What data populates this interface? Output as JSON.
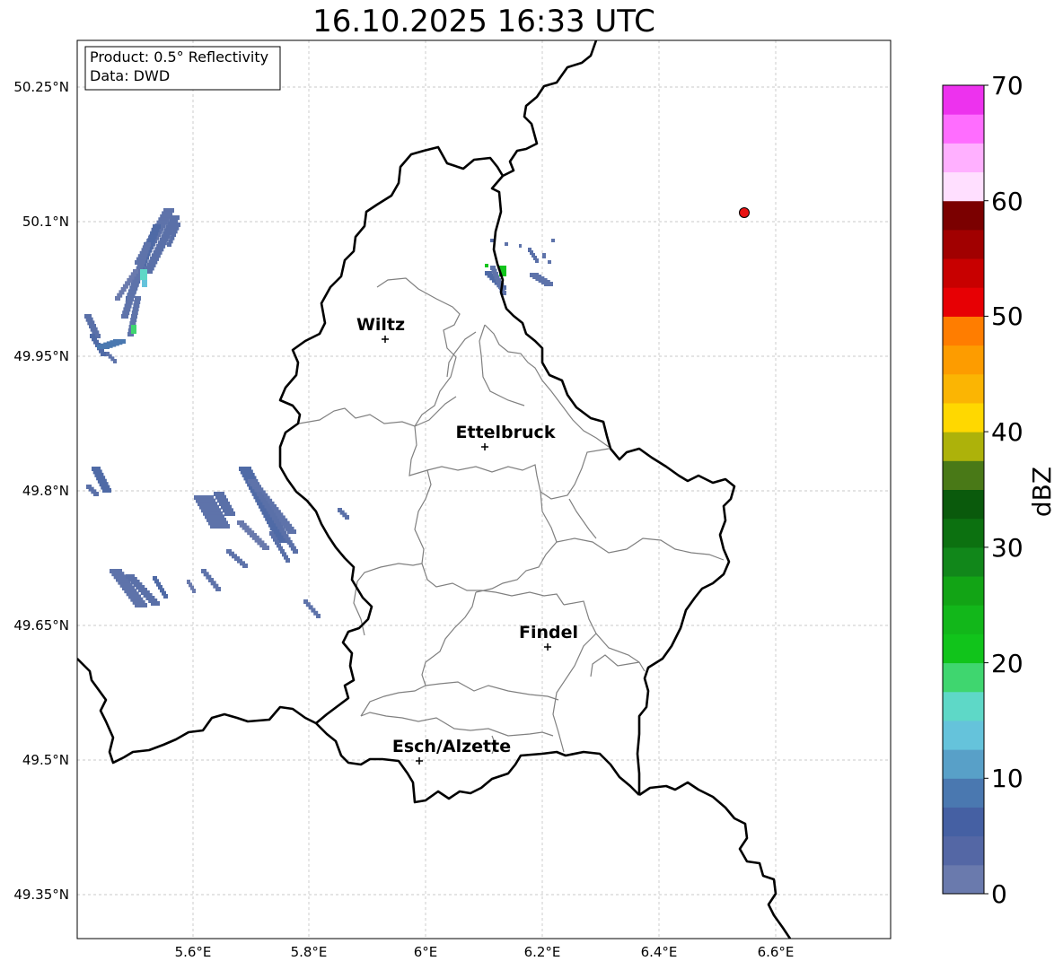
{
  "title": "16.10.2025 16:33 UTC",
  "info_box": {
    "line1": "Product: 0.5° Reflectivity",
    "line2": "Data: DWD"
  },
  "map": {
    "lon_ticks": [
      "5.6°E",
      "5.8°E",
      "6°E",
      "6.2°E",
      "6.4°E",
      "6.6°E"
    ],
    "lat_ticks": [
      "50.25°N",
      "50.1°N",
      "49.95°N",
      "49.8°N",
      "49.65°N",
      "49.5°N",
      "49.35°N"
    ],
    "cities": [
      {
        "name": "Wiltz",
        "marker": "cross"
      },
      {
        "name": "Ettelbruck",
        "marker": "cross"
      },
      {
        "name": "Findel",
        "marker": "cross"
      },
      {
        "name": "Esch/Alzette",
        "marker": "cross"
      }
    ],
    "radar_site": {
      "color": "#e81212"
    },
    "border_color": "#000000",
    "admin_border_color": "#808080",
    "grid": true
  },
  "colorbar": {
    "label": "dBZ",
    "min": 0,
    "max": 70,
    "step": 2.5,
    "tick_labels": [
      "0",
      "10",
      "20",
      "30",
      "40",
      "50",
      "60",
      "70"
    ],
    "colors": [
      "#6a7aad",
      "#5467a5",
      "#4560a3",
      "#4a78b0",
      "#58a0c8",
      "#65c3db",
      "#5ed8c7",
      "#3fd66f",
      "#11c41b",
      "#12b71a",
      "#12a415",
      "#11871a",
      "#0c7110",
      "#0a5a0c",
      "#497917",
      "#adb20a",
      "#ffd800",
      "#fbb503",
      "#fd9c00",
      "#ff7d00",
      "#e70004",
      "#c80000",
      "#a10000",
      "#7b0000",
      "#ffdfff",
      "#ffb0ff",
      "#ff6dff",
      "#ed32ee"
    ]
  }
}
